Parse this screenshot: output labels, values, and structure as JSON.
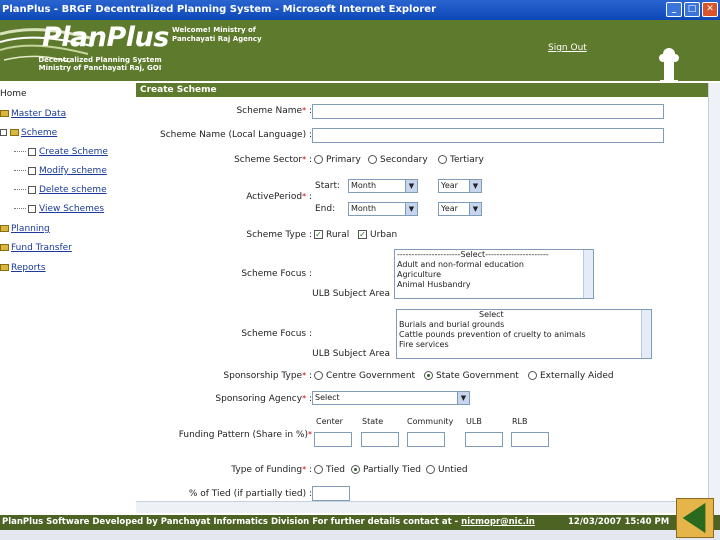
{
  "window": {
    "title": "PlanPlus - BRGF Decentralized Planning System - Microsoft Internet Explorer",
    "buttons": [
      "_",
      "□",
      "✕"
    ]
  },
  "header": {
    "logo": "PlanPlus",
    "logo_sub_1": "Decentralized Planning System",
    "logo_sub_2": "Ministry of Panchayati Raj, GOI",
    "welcome_1": "Welcome! Ministry of",
    "welcome_2": "Panchayati Raj Agency",
    "sign_out": "Sign Out",
    "brand_color": "#5e7a2c"
  },
  "sidebar": {
    "home": "Home",
    "master_data": "Master Data",
    "scheme": "Scheme",
    "create_scheme": "Create Scheme",
    "modify_scheme": "Modify scheme",
    "delete_scheme": "Delete scheme",
    "view_schemes": "View Schemes",
    "planning": "Planning",
    "fund_transfer": "Fund Transfer",
    "reports": "Reports"
  },
  "form": {
    "heading": "Create Scheme",
    "scheme_name_label": "Scheme Name",
    "scheme_name_local_label": "Scheme Name (Local Language) :",
    "scheme_sector_label": "Scheme Sector",
    "sector_options": [
      "Primary",
      "Secondary",
      "Tertiary"
    ],
    "active_period_label": "ActivePeriod",
    "start_label": "Start:",
    "end_label": "End:",
    "month_placeholder": "Month",
    "year_placeholder": "Year",
    "scheme_type_label": "Scheme Type :",
    "type_options": [
      "Rural",
      "Urban"
    ],
    "scheme_focus_label": "Scheme Focus :",
    "ulb_subject_area_label": "ULB Subject Area",
    "focus_list_1": [
      "----------------------Select----------------------",
      "Adult and non-formal education",
      "Agriculture",
      "Animal Husbandry"
    ],
    "focus_list_2": [
      "Select",
      "Burials and burial grounds",
      "Cattle pounds prevention of cruelty to animals",
      "Fire services"
    ],
    "sponsorship_type_label": "Sponsorship Type",
    "sponsorship_options": [
      "Centre Government",
      "State Government",
      "Externally Aided"
    ],
    "sponsoring_agency_label": "Sponsoring Agency",
    "agency_placeholder": "Select",
    "funding_pattern_label": "Funding Pattern (Share in %)",
    "funding_columns": [
      "Center",
      "State",
      "Community",
      "ULB",
      "RLB"
    ],
    "type_of_funding_label": "Type of Funding",
    "funding_options": [
      "Tied",
      "Partially Tied",
      "Untied"
    ],
    "pct_tied_label": "% of Tied (if partially tied) :"
  },
  "footer": {
    "text": "PlanPlus Software Developed by Panchayat Informatics Division For further details contact at - ",
    "email": "nicmopr@nic.in",
    "datetime": "12/03/2007 15:40 PM"
  }
}
